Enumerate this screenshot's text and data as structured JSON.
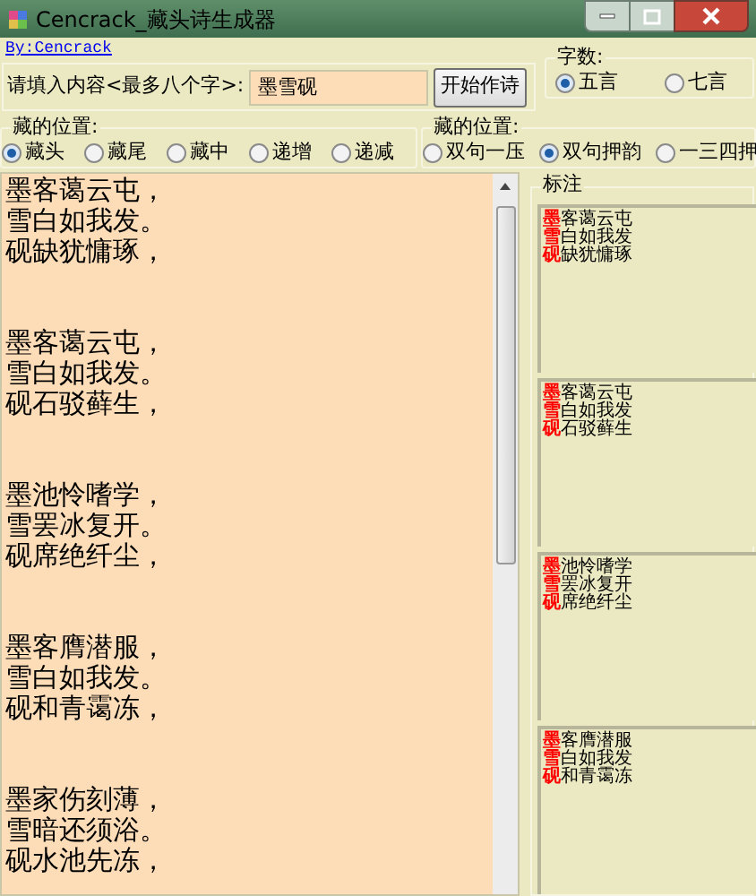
{
  "window": {
    "title": "Cencrack_藏头诗生成器"
  },
  "author_link": "By:Cencrack",
  "input": {
    "label": "请填入内容<最多八个字>:",
    "value": "墨雪砚"
  },
  "start_button": "开始作诗",
  "word_count": {
    "title": "字数:",
    "options": [
      {
        "label": "五言",
        "selected": true
      },
      {
        "label": "七言",
        "selected": false
      }
    ]
  },
  "position": {
    "title": "藏的位置:",
    "options": [
      {
        "label": "藏头",
        "selected": true
      },
      {
        "label": "藏尾",
        "selected": false
      },
      {
        "label": "藏中",
        "selected": false
      },
      {
        "label": "递增",
        "selected": false
      },
      {
        "label": "递减",
        "selected": false
      }
    ]
  },
  "rhyme": {
    "title": "藏的位置:",
    "options": [
      {
        "label": "双句一压",
        "selected": false
      },
      {
        "label": "双句押韵",
        "selected": true
      },
      {
        "label": "一三四押",
        "selected": false
      }
    ]
  },
  "poems": [
    [
      "墨客蔼云屯，",
      "雪白如我发。",
      "砚缺犹慵琢，"
    ],
    [
      "墨客蔼云屯，",
      "雪白如我发。",
      "砚石驳藓生，"
    ],
    [
      "墨池怜嗜学，",
      "雪罢冰复开。",
      "砚席绝纤尘，"
    ],
    [
      "墨客膺潜服，",
      "雪白如我发。",
      "砚和青霭冻，"
    ],
    [
      "墨家伤刻薄，",
      "雪暗还须浴。",
      "砚水池先冻，"
    ]
  ],
  "annotation": {
    "title": "标注",
    "cards": [
      [
        {
          "mark": "墨",
          "rest": "客蔼云屯"
        },
        {
          "mark": "雪",
          "rest": "白如我发"
        },
        {
          "mark": "砚",
          "rest": "缺犹慵琢"
        }
      ],
      [
        {
          "mark": "墨",
          "rest": "客蔼云屯"
        },
        {
          "mark": "雪",
          "rest": "白如我发"
        },
        {
          "mark": "砚",
          "rest": "石驳藓生"
        }
      ],
      [
        {
          "mark": "墨",
          "rest": "池怜嗜学"
        },
        {
          "mark": "雪",
          "rest": "罢冰复开"
        },
        {
          "mark": "砚",
          "rest": "席绝纤尘"
        }
      ],
      [
        {
          "mark": "墨",
          "rest": "客膺潜服"
        },
        {
          "mark": "雪",
          "rest": "白如我发"
        },
        {
          "mark": "砚",
          "rest": "和青霭冻"
        }
      ]
    ]
  }
}
